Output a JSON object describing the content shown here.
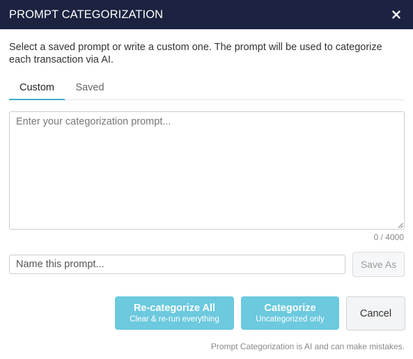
{
  "dialog": {
    "title": "PROMPT CATEGORIZATION",
    "close_icon": "close-x-icon"
  },
  "description": "Select a saved prompt or write a custom one. The prompt will be used to categorize each transaction via AI.",
  "tabs": [
    {
      "label": "Custom",
      "active": true
    },
    {
      "label": "Saved",
      "active": false
    }
  ],
  "prompt": {
    "value": "",
    "placeholder": "Enter your categorization prompt...",
    "counter": "0 / 4000"
  },
  "name_field": {
    "value": "",
    "placeholder": "Name this prompt..."
  },
  "buttons": {
    "save_as": "Save As",
    "recategorize_main": "Re-categorize All",
    "recategorize_sub": "Clear & re-run everything",
    "categorize_main": "Categorize",
    "categorize_sub": "Uncategorized only",
    "cancel": "Cancel"
  },
  "disclaimer": "Prompt Categorization is AI and can make mistakes.",
  "colors": {
    "header_bg": "#1b2340",
    "accent": "#3fa9c9",
    "primary_button": "#6cc9de"
  }
}
